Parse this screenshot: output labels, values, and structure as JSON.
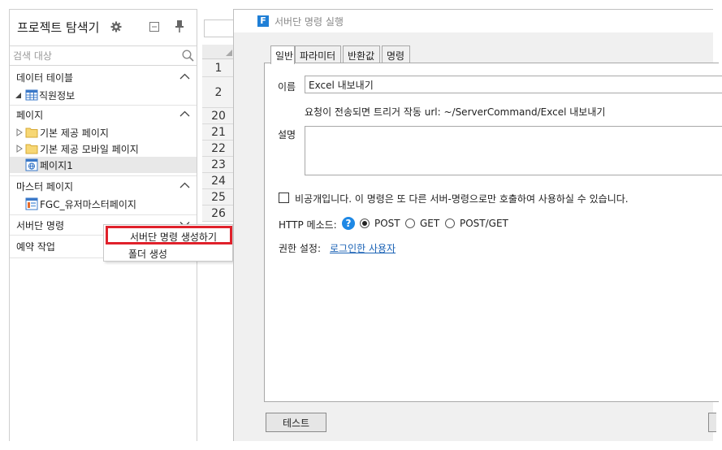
{
  "explorer": {
    "title": "프로젝트 탐색기",
    "search_placeholder": "검색 대상",
    "sections": {
      "data_table": {
        "label": "데이터 테이블",
        "items": [
          "직원정보"
        ]
      },
      "pages": {
        "label": "페이지",
        "items": [
          "기본 제공 페이지",
          "기본 제공 모바일 페이지",
          "페이지1"
        ]
      },
      "master": {
        "label": "마스터 페이지",
        "items": [
          "FGC_유저마스터페이지"
        ]
      },
      "server_command": {
        "label": "서버단 명령"
      },
      "scheduled": {
        "label": "예약 작업"
      }
    }
  },
  "context_menu": {
    "create_label": "서버단 명령 생성하기",
    "folder_label": "폴더 생성"
  },
  "grid": {
    "row_numbers": [
      "1",
      "2",
      "20",
      "21",
      "22",
      "23",
      "24",
      "25",
      "26"
    ]
  },
  "dialog": {
    "title": "서버단 명령 실행",
    "logo_letter": "F",
    "tabs": [
      "일반",
      "파라미터",
      "반환값",
      "명령"
    ],
    "name_label": "이름",
    "name_value": "Excel 내보내기",
    "url_text": "요청이 전송되면 트리거 작동 url: ~/ServerCommand/Excel 내보내기",
    "desc_label": "설명",
    "private_label": "비공개입니다. 이 명령은 또 다른 서버-명령으로만 호출하여 사용하실 수 있습니다.",
    "http_label": "HTTP 메소드:",
    "methods": [
      "POST",
      "GET",
      "POST/GET"
    ],
    "selected_method": "POST",
    "permission_label": "권한 설정:",
    "permission_link": "로그인한 사용자",
    "test_button": "테스트"
  },
  "colors": {
    "highlight": "#e0212b",
    "link": "#1a62b5",
    "help": "#1e88e5",
    "logo": "#1f7fd6"
  }
}
